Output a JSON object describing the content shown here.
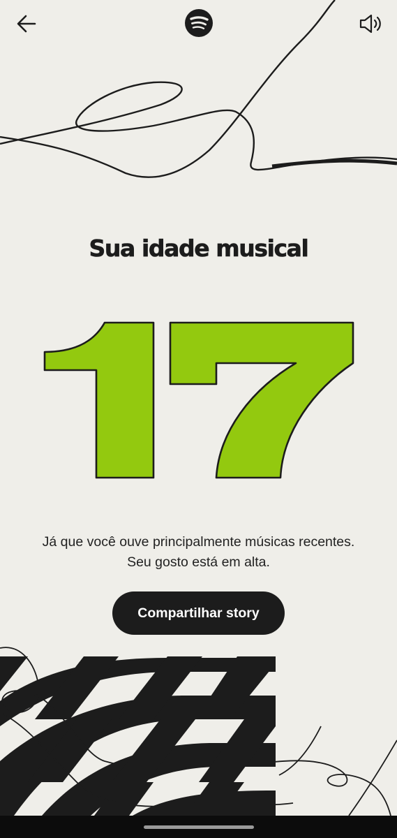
{
  "header": {
    "back_icon": "arrow-left-icon",
    "logo_icon": "spotify-logo-icon",
    "sound_icon": "speaker-icon"
  },
  "main": {
    "title": "Sua idade musical",
    "age_value": "17",
    "description_line1": "Já que você ouve principalmente músicas recentes.",
    "description_line2": "Seu gosto está em alta.",
    "share_label": "Compartilhar story"
  },
  "colors": {
    "background": "#efeee9",
    "accent_green": "#93c90f",
    "ink": "#1c1c1c"
  }
}
